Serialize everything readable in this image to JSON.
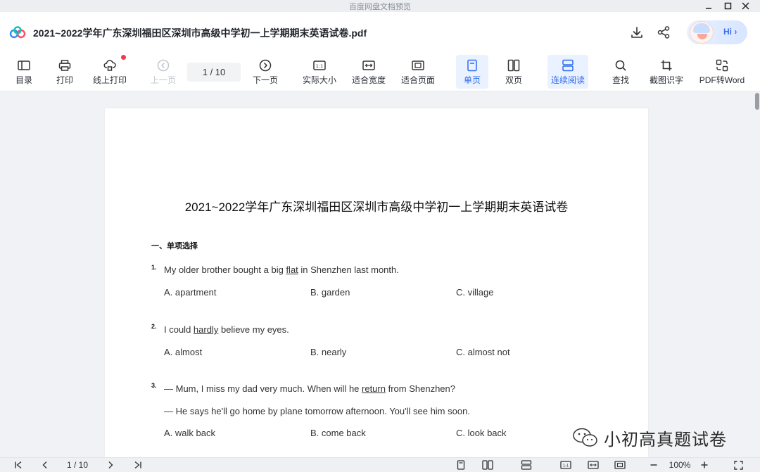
{
  "window": {
    "title": "百度网盘文档预览"
  },
  "header": {
    "doc_title": "2021~2022学年广东深圳福田区深圳市高级中学初一上学期期末英语试卷.pdf",
    "assistant_label": "Hi ›"
  },
  "toolbar": {
    "toc": "目录",
    "print": "打印",
    "online_print": "线上打印",
    "prev_page": "上一页",
    "page_indicator": "1  / 10",
    "next_page": "下一页",
    "actual_size": "实际大小",
    "fit_width": "适合宽度",
    "fit_page": "适合页面",
    "single_page": "单页",
    "double_page": "双页",
    "continuous": "连续阅读",
    "find": "查找",
    "ocr": "截图识字",
    "to_word": "PDF转Word"
  },
  "document": {
    "title": "2021~2022学年广东深圳福田区深圳市高级中学初一上学期期末英语试卷",
    "section": "一、单项选择",
    "questions": [
      {
        "num": "1.",
        "pre": "My older brother bought a big ",
        "key": "flat",
        "post": " in Shenzhen last month.",
        "options": [
          "A. apartment",
          "B. garden",
          "C. village"
        ]
      },
      {
        "num": "2.",
        "pre": "I could ",
        "key": "hardly",
        "post": " believe my eyes.",
        "options": [
          "A. almost",
          "B. nearly",
          "C. almost not"
        ]
      },
      {
        "num": "3.",
        "pre": "— Mum, I miss my dad very much. When will he ",
        "key": "return",
        "post": " from Shenzhen?",
        "line2": "— He says he'll go home by plane tomorrow afternoon. You'll see him soon.",
        "options": [
          "A. walk back",
          "B. come back",
          "C. look back"
        ]
      }
    ]
  },
  "bottombar": {
    "page_indicator": "1 / 10",
    "zoom": "100%"
  },
  "watermark": {
    "text": "小初高真题试卷"
  },
  "colors": {
    "accent": "#2f6bef",
    "active_bg": "#eaf1ff",
    "notify_dot": "#f5384a"
  }
}
